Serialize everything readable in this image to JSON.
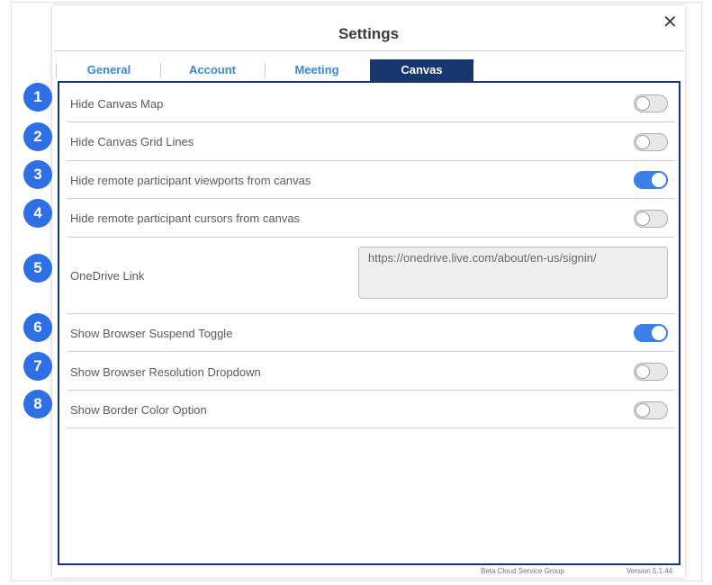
{
  "dialog": {
    "title": "Settings",
    "close_icon": "close-icon"
  },
  "tabs": [
    {
      "label": "General",
      "active": false
    },
    {
      "label": "Account",
      "active": false
    },
    {
      "label": "Meeting",
      "active": false
    },
    {
      "label": "Canvas",
      "active": true
    }
  ],
  "settings": [
    {
      "number": "1",
      "label": "Hide Canvas Map",
      "control": "toggle",
      "on": false
    },
    {
      "number": "2",
      "label": "Hide Canvas Grid Lines",
      "control": "toggle",
      "on": false
    },
    {
      "number": "3",
      "label": "Hide remote participant viewports from canvas",
      "control": "toggle",
      "on": true
    },
    {
      "number": "4",
      "label": "Hide remote participant cursors from canvas",
      "control": "toggle",
      "on": false
    },
    {
      "number": "5",
      "label": "OneDrive Link",
      "control": "text",
      "value": "https://onedrive.live.com/about/en-us/signin/"
    },
    {
      "number": "6",
      "label": "Show Browser Suspend Toggle",
      "control": "toggle",
      "on": true
    },
    {
      "number": "7",
      "label": "Show Browser Resolution Dropdown",
      "control": "toggle",
      "on": false
    },
    {
      "number": "8",
      "label": "Show Border Color Option",
      "control": "toggle",
      "on": false
    }
  ],
  "footer": {
    "company": "Beta Cloud Service Group",
    "version": "Version 5.1.44"
  },
  "colors": {
    "accent": "#17376e",
    "tab_text": "#3d86d8",
    "toggle_on": "#3b80e6",
    "badge": "#2f6fe6"
  }
}
